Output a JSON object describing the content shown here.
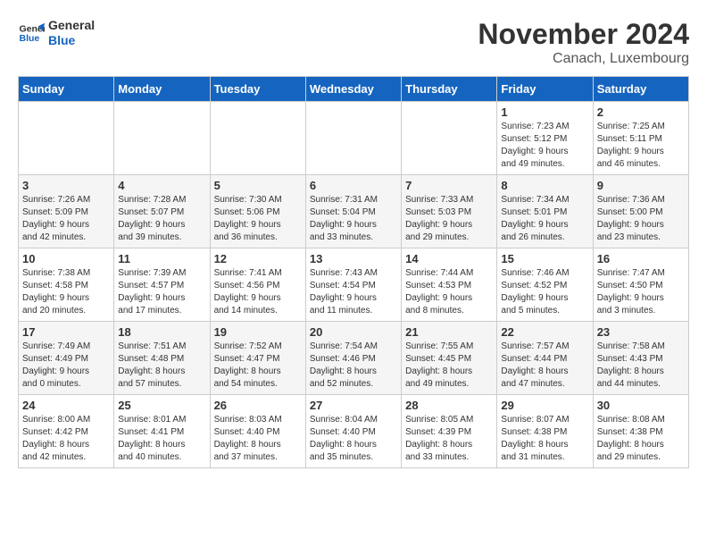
{
  "header": {
    "logo_line1": "General",
    "logo_line2": "Blue",
    "title": "November 2024",
    "subtitle": "Canach, Luxembourg"
  },
  "weekdays": [
    "Sunday",
    "Monday",
    "Tuesday",
    "Wednesday",
    "Thursday",
    "Friday",
    "Saturday"
  ],
  "weeks": [
    [
      {
        "day": "",
        "info": ""
      },
      {
        "day": "",
        "info": ""
      },
      {
        "day": "",
        "info": ""
      },
      {
        "day": "",
        "info": ""
      },
      {
        "day": "",
        "info": ""
      },
      {
        "day": "1",
        "info": "Sunrise: 7:23 AM\nSunset: 5:12 PM\nDaylight: 9 hours\nand 49 minutes."
      },
      {
        "day": "2",
        "info": "Sunrise: 7:25 AM\nSunset: 5:11 PM\nDaylight: 9 hours\nand 46 minutes."
      }
    ],
    [
      {
        "day": "3",
        "info": "Sunrise: 7:26 AM\nSunset: 5:09 PM\nDaylight: 9 hours\nand 42 minutes."
      },
      {
        "day": "4",
        "info": "Sunrise: 7:28 AM\nSunset: 5:07 PM\nDaylight: 9 hours\nand 39 minutes."
      },
      {
        "day": "5",
        "info": "Sunrise: 7:30 AM\nSunset: 5:06 PM\nDaylight: 9 hours\nand 36 minutes."
      },
      {
        "day": "6",
        "info": "Sunrise: 7:31 AM\nSunset: 5:04 PM\nDaylight: 9 hours\nand 33 minutes."
      },
      {
        "day": "7",
        "info": "Sunrise: 7:33 AM\nSunset: 5:03 PM\nDaylight: 9 hours\nand 29 minutes."
      },
      {
        "day": "8",
        "info": "Sunrise: 7:34 AM\nSunset: 5:01 PM\nDaylight: 9 hours\nand 26 minutes."
      },
      {
        "day": "9",
        "info": "Sunrise: 7:36 AM\nSunset: 5:00 PM\nDaylight: 9 hours\nand 23 minutes."
      }
    ],
    [
      {
        "day": "10",
        "info": "Sunrise: 7:38 AM\nSunset: 4:58 PM\nDaylight: 9 hours\nand 20 minutes."
      },
      {
        "day": "11",
        "info": "Sunrise: 7:39 AM\nSunset: 4:57 PM\nDaylight: 9 hours\nand 17 minutes."
      },
      {
        "day": "12",
        "info": "Sunrise: 7:41 AM\nSunset: 4:56 PM\nDaylight: 9 hours\nand 14 minutes."
      },
      {
        "day": "13",
        "info": "Sunrise: 7:43 AM\nSunset: 4:54 PM\nDaylight: 9 hours\nand 11 minutes."
      },
      {
        "day": "14",
        "info": "Sunrise: 7:44 AM\nSunset: 4:53 PM\nDaylight: 9 hours\nand 8 minutes."
      },
      {
        "day": "15",
        "info": "Sunrise: 7:46 AM\nSunset: 4:52 PM\nDaylight: 9 hours\nand 5 minutes."
      },
      {
        "day": "16",
        "info": "Sunrise: 7:47 AM\nSunset: 4:50 PM\nDaylight: 9 hours\nand 3 minutes."
      }
    ],
    [
      {
        "day": "17",
        "info": "Sunrise: 7:49 AM\nSunset: 4:49 PM\nDaylight: 9 hours\nand 0 minutes."
      },
      {
        "day": "18",
        "info": "Sunrise: 7:51 AM\nSunset: 4:48 PM\nDaylight: 8 hours\nand 57 minutes."
      },
      {
        "day": "19",
        "info": "Sunrise: 7:52 AM\nSunset: 4:47 PM\nDaylight: 8 hours\nand 54 minutes."
      },
      {
        "day": "20",
        "info": "Sunrise: 7:54 AM\nSunset: 4:46 PM\nDaylight: 8 hours\nand 52 minutes."
      },
      {
        "day": "21",
        "info": "Sunrise: 7:55 AM\nSunset: 4:45 PM\nDaylight: 8 hours\nand 49 minutes."
      },
      {
        "day": "22",
        "info": "Sunrise: 7:57 AM\nSunset: 4:44 PM\nDaylight: 8 hours\nand 47 minutes."
      },
      {
        "day": "23",
        "info": "Sunrise: 7:58 AM\nSunset: 4:43 PM\nDaylight: 8 hours\nand 44 minutes."
      }
    ],
    [
      {
        "day": "24",
        "info": "Sunrise: 8:00 AM\nSunset: 4:42 PM\nDaylight: 8 hours\nand 42 minutes."
      },
      {
        "day": "25",
        "info": "Sunrise: 8:01 AM\nSunset: 4:41 PM\nDaylight: 8 hours\nand 40 minutes."
      },
      {
        "day": "26",
        "info": "Sunrise: 8:03 AM\nSunset: 4:40 PM\nDaylight: 8 hours\nand 37 minutes."
      },
      {
        "day": "27",
        "info": "Sunrise: 8:04 AM\nSunset: 4:40 PM\nDaylight: 8 hours\nand 35 minutes."
      },
      {
        "day": "28",
        "info": "Sunrise: 8:05 AM\nSunset: 4:39 PM\nDaylight: 8 hours\nand 33 minutes."
      },
      {
        "day": "29",
        "info": "Sunrise: 8:07 AM\nSunset: 4:38 PM\nDaylight: 8 hours\nand 31 minutes."
      },
      {
        "day": "30",
        "info": "Sunrise: 8:08 AM\nSunset: 4:38 PM\nDaylight: 8 hours\nand 29 minutes."
      }
    ]
  ]
}
